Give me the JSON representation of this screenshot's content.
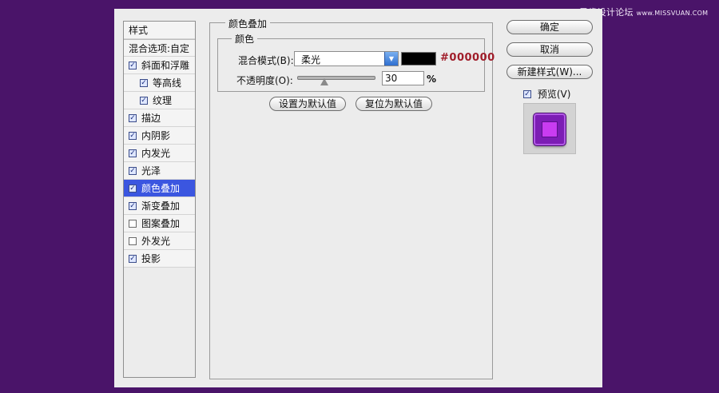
{
  "watermark": {
    "text": "思缘设计论坛",
    "url": "www.MISSVUAN.COM"
  },
  "styles_panel": {
    "header": "样式",
    "blend_options": "混合选项:自定",
    "items": [
      {
        "label": "斜面和浮雕",
        "checked": true,
        "indent": 0
      },
      {
        "label": "等高线",
        "checked": true,
        "indent": 1
      },
      {
        "label": "纹理",
        "checked": true,
        "indent": 1
      },
      {
        "label": "描边",
        "checked": true,
        "indent": 0
      },
      {
        "label": "内阴影",
        "checked": true,
        "indent": 0
      },
      {
        "label": "内发光",
        "checked": true,
        "indent": 0
      },
      {
        "label": "光泽",
        "checked": true,
        "indent": 0
      },
      {
        "label": "颜色叠加",
        "checked": true,
        "indent": 0,
        "selected": true
      },
      {
        "label": "渐变叠加",
        "checked": true,
        "indent": 0
      },
      {
        "label": "图案叠加",
        "checked": false,
        "indent": 0
      },
      {
        "label": "外发光",
        "checked": false,
        "indent": 0
      },
      {
        "label": "投影",
        "checked": true,
        "indent": 0
      }
    ]
  },
  "color_overlay": {
    "title": "颜色叠加",
    "group_title": "颜色",
    "blend_mode_label": "混合模式(B):",
    "blend_mode_value": "柔光",
    "color_hex": "#000000",
    "color_swatch": "#000000",
    "opacity_label": "不透明度(O):",
    "opacity_value": "30",
    "opacity_unit": "%",
    "opacity_fraction": 0.3,
    "set_default": "设置为默认值",
    "reset_default": "复位为默认值"
  },
  "buttons": {
    "ok": "确定",
    "cancel": "取消",
    "new_style": "新建样式(W)..."
  },
  "preview": {
    "label": "预览(V)",
    "checked": true
  },
  "colors": {
    "background": "#4a1469",
    "selection": "#3b56e0",
    "hex_text": "#a01d2a",
    "preview_fill": "#7c1db4"
  }
}
